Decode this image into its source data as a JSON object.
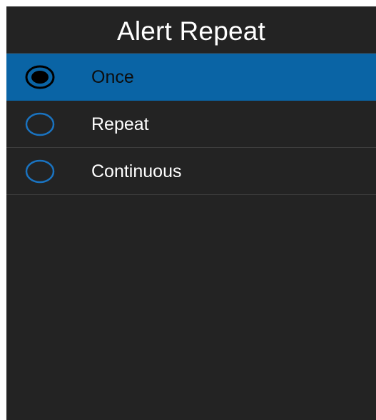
{
  "header": {
    "title": "Alert Repeat"
  },
  "options": [
    {
      "label": "Once",
      "selected": true,
      "icon": "radio-selected-icon"
    },
    {
      "label": "Repeat",
      "selected": false,
      "icon": "radio-unselected-icon"
    },
    {
      "label": "Continuous",
      "selected": false,
      "icon": "radio-unselected-icon"
    }
  ],
  "colors": {
    "background": "#232323",
    "selected_row": "#0a64a5",
    "radio_ring": "#1a73c0",
    "selected_text": "#0d0d0d",
    "text": "#ffffff"
  }
}
